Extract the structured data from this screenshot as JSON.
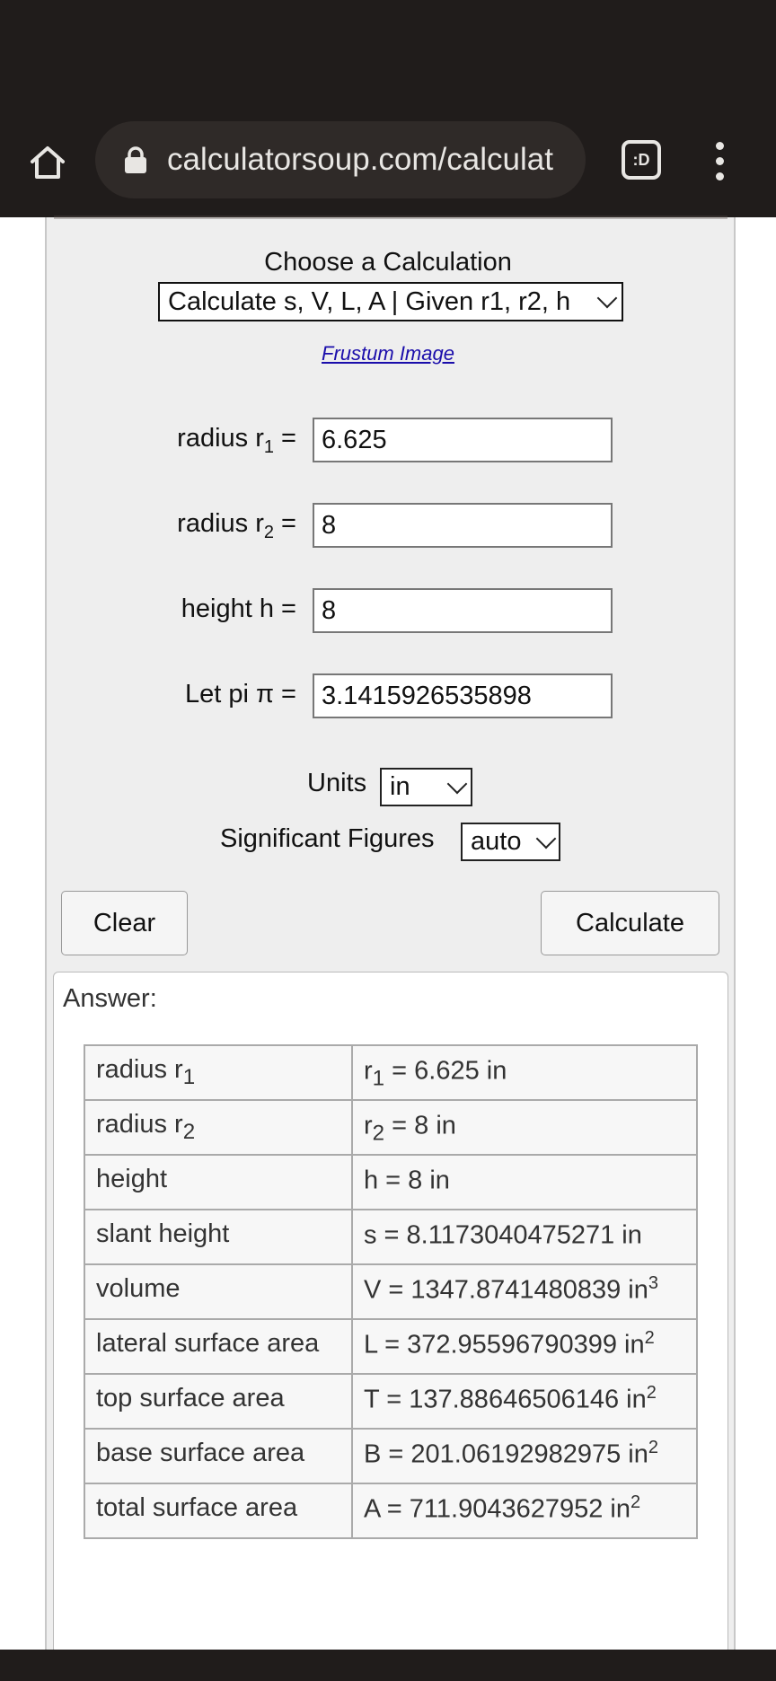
{
  "browser": {
    "url": "calculatorsoup.com/calculat",
    "tab_switcher_label": ":D"
  },
  "calculator": {
    "choose_title": "Choose a Calculation",
    "calculation_selected": "Calculate s, V, L, A | Given r1, r2, h",
    "image_link": "Frustum Image",
    "inputs": {
      "r1": {
        "label_main": "radius r",
        "label_sub": "1",
        "label_eq": " =",
        "value": "6.625"
      },
      "r2": {
        "label_main": "radius r",
        "label_sub": "2",
        "label_eq": " =",
        "value": "8"
      },
      "h": {
        "label": "height h =",
        "value": "8"
      },
      "pi": {
        "label": "Let pi π =",
        "value": "3.1415926535898"
      }
    },
    "units_label": "Units",
    "units_selected": "in",
    "sig_fig_label": "Significant Figures",
    "sig_fig_selected": "auto",
    "clear_label": "Clear",
    "calculate_label": "Calculate"
  },
  "answer": {
    "label": "Answer:",
    "rows": [
      {
        "name_main": "radius r",
        "name_sub": "1",
        "val_pre": "r",
        "val_sub": "1",
        "val_main": " = 6.625 in",
        "val_sup": ""
      },
      {
        "name_main": "radius r",
        "name_sub": "2",
        "val_pre": "r",
        "val_sub": "2",
        "val_main": " = 8 in",
        "val_sup": ""
      },
      {
        "name_main": "height",
        "name_sub": "",
        "val_pre": "",
        "val_sub": "",
        "val_main": "h = 8 in",
        "val_sup": ""
      },
      {
        "name_main": "slant height",
        "name_sub": "",
        "val_pre": "",
        "val_sub": "",
        "val_main": "s = 8.1173040475271 in",
        "val_sup": ""
      },
      {
        "name_main": "volume",
        "name_sub": "",
        "val_pre": "",
        "val_sub": "",
        "val_main": "V = 1347.8741480839 in",
        "val_sup": "3"
      },
      {
        "name_main": "lateral surface area",
        "name_sub": "",
        "val_pre": "",
        "val_sub": "",
        "val_main": "L = 372.95596790399 in",
        "val_sup": "2"
      },
      {
        "name_main": "top surface area",
        "name_sub": "",
        "val_pre": "",
        "val_sub": "",
        "val_main": "T = 137.88646506146 in",
        "val_sup": "2"
      },
      {
        "name_main": "base surface area",
        "name_sub": "",
        "val_pre": "",
        "val_sub": "",
        "val_main": "B = 201.06192982975 in",
        "val_sup": "2"
      },
      {
        "name_main": "total surface area",
        "name_sub": "",
        "val_pre": "",
        "val_sub": "",
        "val_main": "A = 711.9043627952 in",
        "val_sup": "2"
      }
    ]
  },
  "icons": {
    "home": "home-icon",
    "lock": "lock-icon",
    "menu": "more-vertical-icon",
    "dropdown": "chevron-down-icon"
  }
}
